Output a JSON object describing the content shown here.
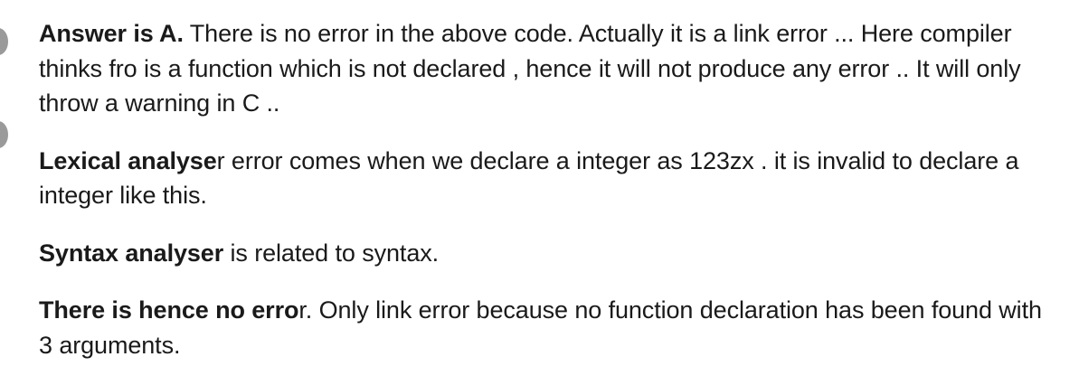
{
  "paragraphs": [
    {
      "bold": "Answer is A.",
      "text": " There is no error in the above code. Actually it is a link error ... Here compiler thinks fro is a function which is not declared , hence it will not produce any error .. It will only throw a warning in C .."
    },
    {
      "bold": "Lexical analyse",
      "text": "r error comes when we declare a integer as 123zx . it is invalid to declare a integer like this."
    },
    {
      "bold": "Syntax analyser",
      "text": " is related to syntax."
    },
    {
      "bold": "There is hence no erro",
      "text": "r. Only link error because no function declaration has been found with 3 arguments."
    }
  ]
}
